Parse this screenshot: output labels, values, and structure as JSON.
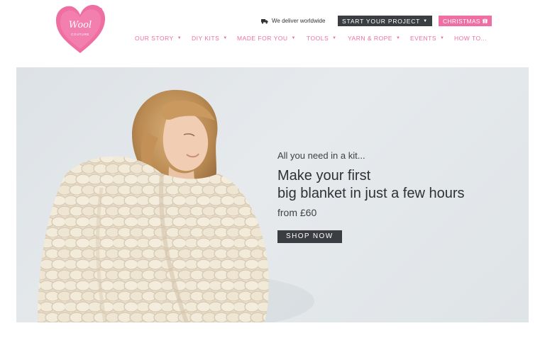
{
  "brand": {
    "logo_text": "Wool",
    "logo_subtext": "COUTURE",
    "logo_color": "#ef6fa3"
  },
  "utility": {
    "deliver_icon": "truck-icon",
    "deliver_text": "We deliver worldwide",
    "project_button": "START YOUR PROJECT",
    "christmas_button": "CHRISTMAS",
    "christmas_icon": "gift-icon"
  },
  "nav": {
    "items": [
      {
        "label": "OUR STORY",
        "dropdown": true
      },
      {
        "label": "DIY KITS",
        "dropdown": true
      },
      {
        "label": "MADE FOR YOU",
        "dropdown": true
      },
      {
        "label": "TOOLS",
        "dropdown": true
      },
      {
        "label": "YARN & ROPE",
        "dropdown": true
      },
      {
        "label": "EVENTS",
        "dropdown": true
      },
      {
        "label": "HOW TO...",
        "dropdown": false
      }
    ],
    "color": "#ef6fa3"
  },
  "hero": {
    "kicker": "All you need in a kit...",
    "headline_line1": "Make your first",
    "headline_line2": "big blanket in just a few hours",
    "price": "from £60",
    "cta": "SHOP NOW",
    "cta_color": "#3a3d42"
  }
}
